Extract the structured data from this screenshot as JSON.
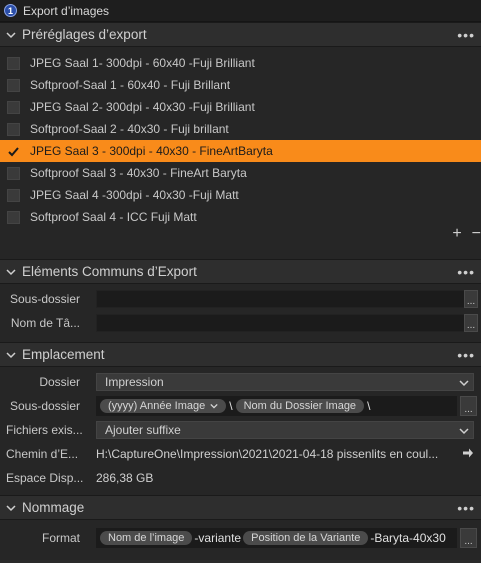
{
  "window": {
    "title": "Export d’images"
  },
  "presets_section": {
    "title": "Préréglages d’export",
    "items": [
      {
        "label": "JPEG Saal 1- 300dpi - 60x40 -Fuji Brilliant",
        "checked": false
      },
      {
        "label": "Softproof-Saal 1 - 60x40 - Fuji Brillant",
        "checked": false
      },
      {
        "label": "JPEG Saal 2- 300dpi - 40x30 -Fuji Brilliant",
        "checked": false
      },
      {
        "label": "Softproof-Saal 2 - 40x30 - Fuji brillant",
        "checked": false
      },
      {
        "label": "JPEG Saal 3 - 300dpi - 40x30 - FineArtBaryta",
        "checked": true
      },
      {
        "label": "Softproof Saal 3 - 40x30 - FineArt Baryta",
        "checked": false
      },
      {
        "label": "JPEG Saal 4 -300dpi - 40x30 -Fuji Matt",
        "checked": false
      },
      {
        "label": "Softproof Saal 4 - ICC Fuji Matt",
        "checked": false
      }
    ],
    "add_label": "+",
    "remove_label": "−"
  },
  "common_section": {
    "title": "Eléments Communs d’Export",
    "subfolder_label": "Sous-dossier",
    "filename_label": "Nom de Tâ...",
    "subfolder_value": "",
    "filename_value": ""
  },
  "location_section": {
    "title": "Emplacement",
    "folder_label": "Dossier",
    "folder_value": "Impression",
    "subfolder_label": "Sous-dossier",
    "subfolder_token1": "(yyyy) Année Image",
    "subfolder_sep1": "\\",
    "subfolder_token2": "Nom du Dossier Image",
    "subfolder_sep2": "\\",
    "existing_files_label": "Fichiers exis...",
    "existing_files_value": "Ajouter suffixe",
    "path_label": "Chemin d’E...",
    "path_value": "H:\\CaptureOne\\Impression\\2021\\2021-04-18 pissenlits en coul...",
    "space_label": "Espace Disp...",
    "space_value": "286,38 GB"
  },
  "naming_section": {
    "title": "Nommage",
    "format_label": "Format",
    "format_token1": "Nom de l’image",
    "format_text1": "-variante",
    "format_token2": "Position de la Variante",
    "format_text2": "-Baryta-40x30"
  },
  "browse_label": "...",
  "menu_dots": "•••"
}
